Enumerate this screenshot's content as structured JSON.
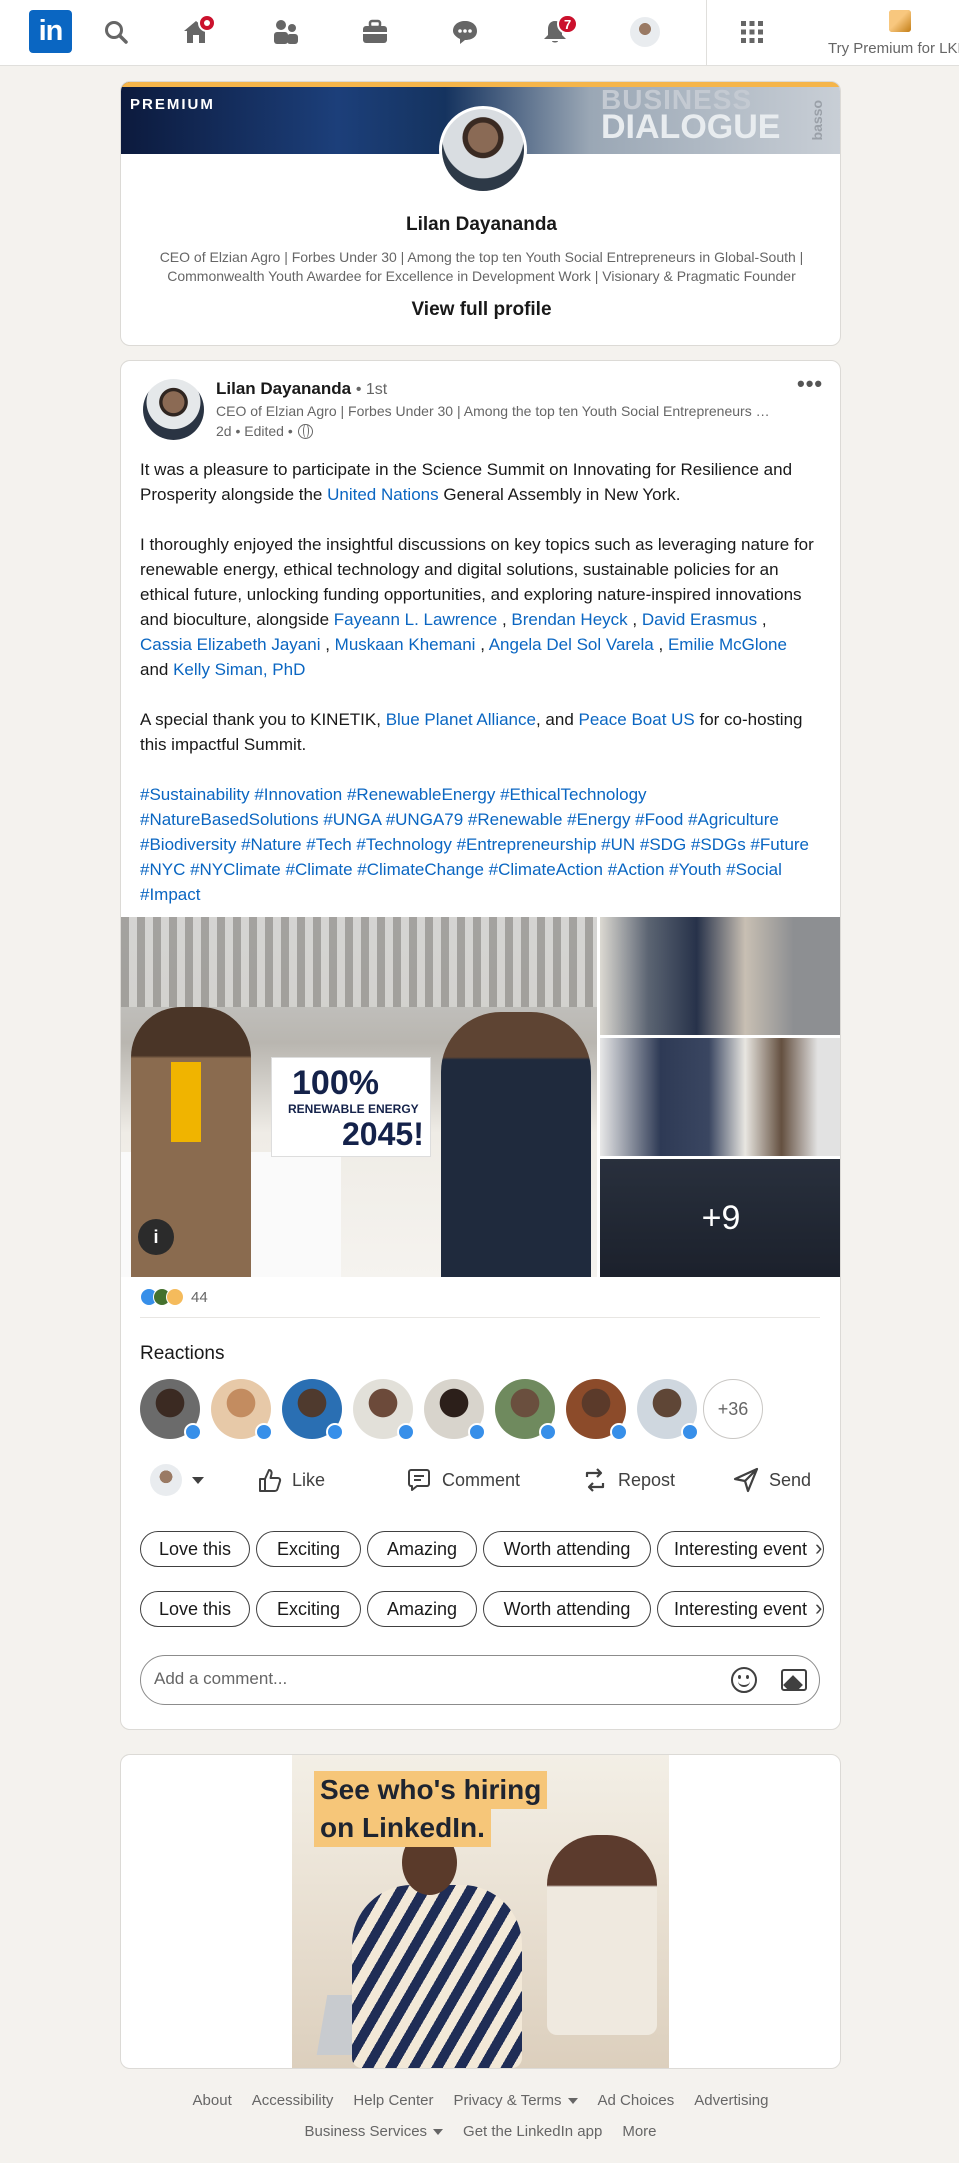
{
  "nav": {
    "logo": "in",
    "notifications_badge": "7",
    "premium_label": "Try Premium for LKR",
    "icons": [
      "search-icon",
      "home-icon",
      "my-network-icon",
      "jobs-icon",
      "messaging-icon",
      "notifications-icon",
      "me-avatar",
      "work-grid-icon",
      "premium-icon"
    ]
  },
  "profile_card": {
    "banner_label": "PREMIUM",
    "banner_text_1": "BUSINESS",
    "banner_text_2": "DIALOGUE",
    "banner_text_3": "basso",
    "name": "Lilan Dayananda",
    "headline": "CEO of Elzian Agro | Forbes Under 30 | Among the top ten Youth Social Entrepreneurs in Global-South | Commonwealth Youth Awardee for Excellence in Development Work | Visionary & Pragmatic Founder",
    "view_profile": "View full profile"
  },
  "post": {
    "author": "Lilan Dayananda",
    "degree": "• 1st",
    "headline": "CEO of Elzian Agro | Forbes Under 30 | Among the top ten Youth Social Entrepreneurs in Global-South | Commonwealth Youth Awardee",
    "time": "2d • Edited •",
    "more": "•••",
    "para1_a": "It was a pleasure to participate in the Science Summit on Innovating for Resilience and Prosperity alongside the ",
    "para1_link": "United Nations",
    "para1_b": " General Assembly in New York.",
    "para2_a": "I thoroughly enjoyed the insightful discussions on key topics such as leveraging nature for renewable energy, ethical technology and digital solutions, sustainable policies for an ethical future, unlocking funding opportunities, and exploring nature-inspired innovations and bioculture, alongside ",
    "mention1": "Fayeann L. Lawrence",
    "mention2": "Brendan Heyck",
    "mention3": "David Erasmus",
    "mention4": "Cassia Elizabeth Jayani",
    "mention5": "Muskaan Khemani",
    "mention6": "Angela Del Sol Varela",
    "mention7": "Emilie McGlone",
    "and_text": " and ",
    "mention8": "Kelly Siman, PhD",
    "para3_a": "A special thank you to KINETIK, ",
    "para3_link1": "Blue Planet Alliance",
    "para3_mid": ", and ",
    "para3_link2": "Peace Boat US",
    "para3_b": " for co-hosting this impactful Summit.",
    "hashtags": "#Sustainability #Innovation #RenewableEnergy #EthicalTechnology #NatureBasedSolutions #UNGA #UNGA79 #Renewable #Energy #Food #Agriculture #Biodiversity #Nature #Tech #Technology #Entrepreneurship #UN #SDG #SDGs #Future #NYC #NYClimate #Climate #ClimateChange #ClimateAction #Action #Youth #Social #Impact",
    "photo_sign_big": "100%",
    "photo_sign_small": "RENEWABLE ENERGY",
    "photo_sign_year": "2045!",
    "more_photos": "+9",
    "reaction_count": "44",
    "reactions_title": "Reactions",
    "more_reactors": "+36",
    "actions": {
      "like": "Like",
      "comment": "Comment",
      "repost": "Repost",
      "send": "Send"
    },
    "suggestions": [
      "Love this",
      "Exciting",
      "Amazing",
      "Worth attending",
      "Interesting event"
    ],
    "comment_placeholder": "Add a comment..."
  },
  "ad": {
    "headline_1": "See who's hiring",
    "headline_2": "on LinkedIn."
  },
  "footer": {
    "row1": [
      "About",
      "Accessibility",
      "Help Center",
      "Privacy & Terms",
      "Ad Choices",
      "Advertising"
    ],
    "row2": [
      "Business Services",
      "Get the LinkedIn app",
      "More"
    ]
  },
  "colors": {
    "brand": "#0a66c2",
    "badge": "#cb112d",
    "background": "#f4f2ee"
  }
}
